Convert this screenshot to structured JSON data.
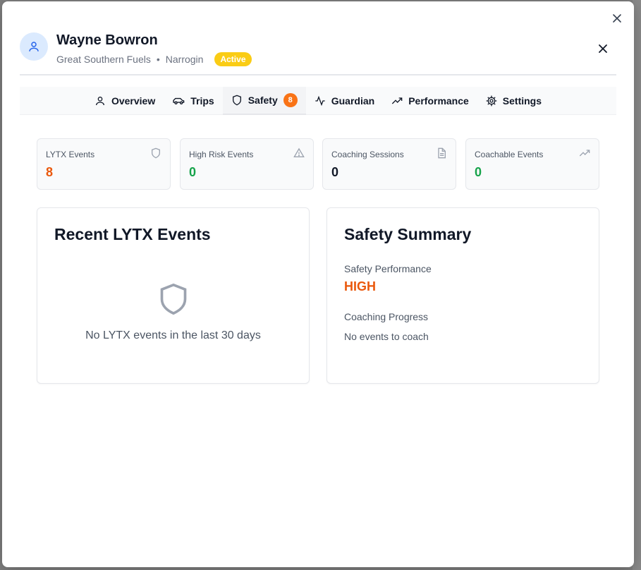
{
  "driver": {
    "name": "Wayne Bowron",
    "company": "Great Southern Fuels",
    "separator": "•",
    "location": "Narrogin",
    "status": "Active"
  },
  "tabs": [
    {
      "label": "Overview",
      "icon": "user-icon"
    },
    {
      "label": "Trips",
      "icon": "car-icon"
    },
    {
      "label": "Safety",
      "icon": "shield-icon",
      "count": "8",
      "active": true
    },
    {
      "label": "Guardian",
      "icon": "activity-icon"
    },
    {
      "label": "Performance",
      "icon": "trending-up-icon"
    },
    {
      "label": "Settings",
      "icon": "gear-icon"
    }
  ],
  "stats": [
    {
      "label": "LYTX Events",
      "value": "8",
      "color": "#ea580c",
      "icon": "shield-icon"
    },
    {
      "label": "High Risk Events",
      "value": "0",
      "color": "#16a34a",
      "icon": "warning-icon"
    },
    {
      "label": "Coaching Sessions",
      "value": "0",
      "color": "#111827",
      "icon": "document-icon"
    },
    {
      "label": "Coachable Events",
      "value": "0",
      "color": "#16a34a",
      "icon": "trending-up-icon"
    }
  ],
  "recent": {
    "title": "Recent LYTX Events",
    "empty_text": "No LYTX events in the last 30 days"
  },
  "summary": {
    "title": "Safety Summary",
    "performance_label": "Safety Performance",
    "performance_value": "HIGH",
    "coaching_label": "Coaching Progress",
    "coaching_note": "No events to coach"
  },
  "colors": {
    "accent_orange": "#f97316",
    "status_yellow": "#facc15",
    "good_green": "#16a34a"
  }
}
